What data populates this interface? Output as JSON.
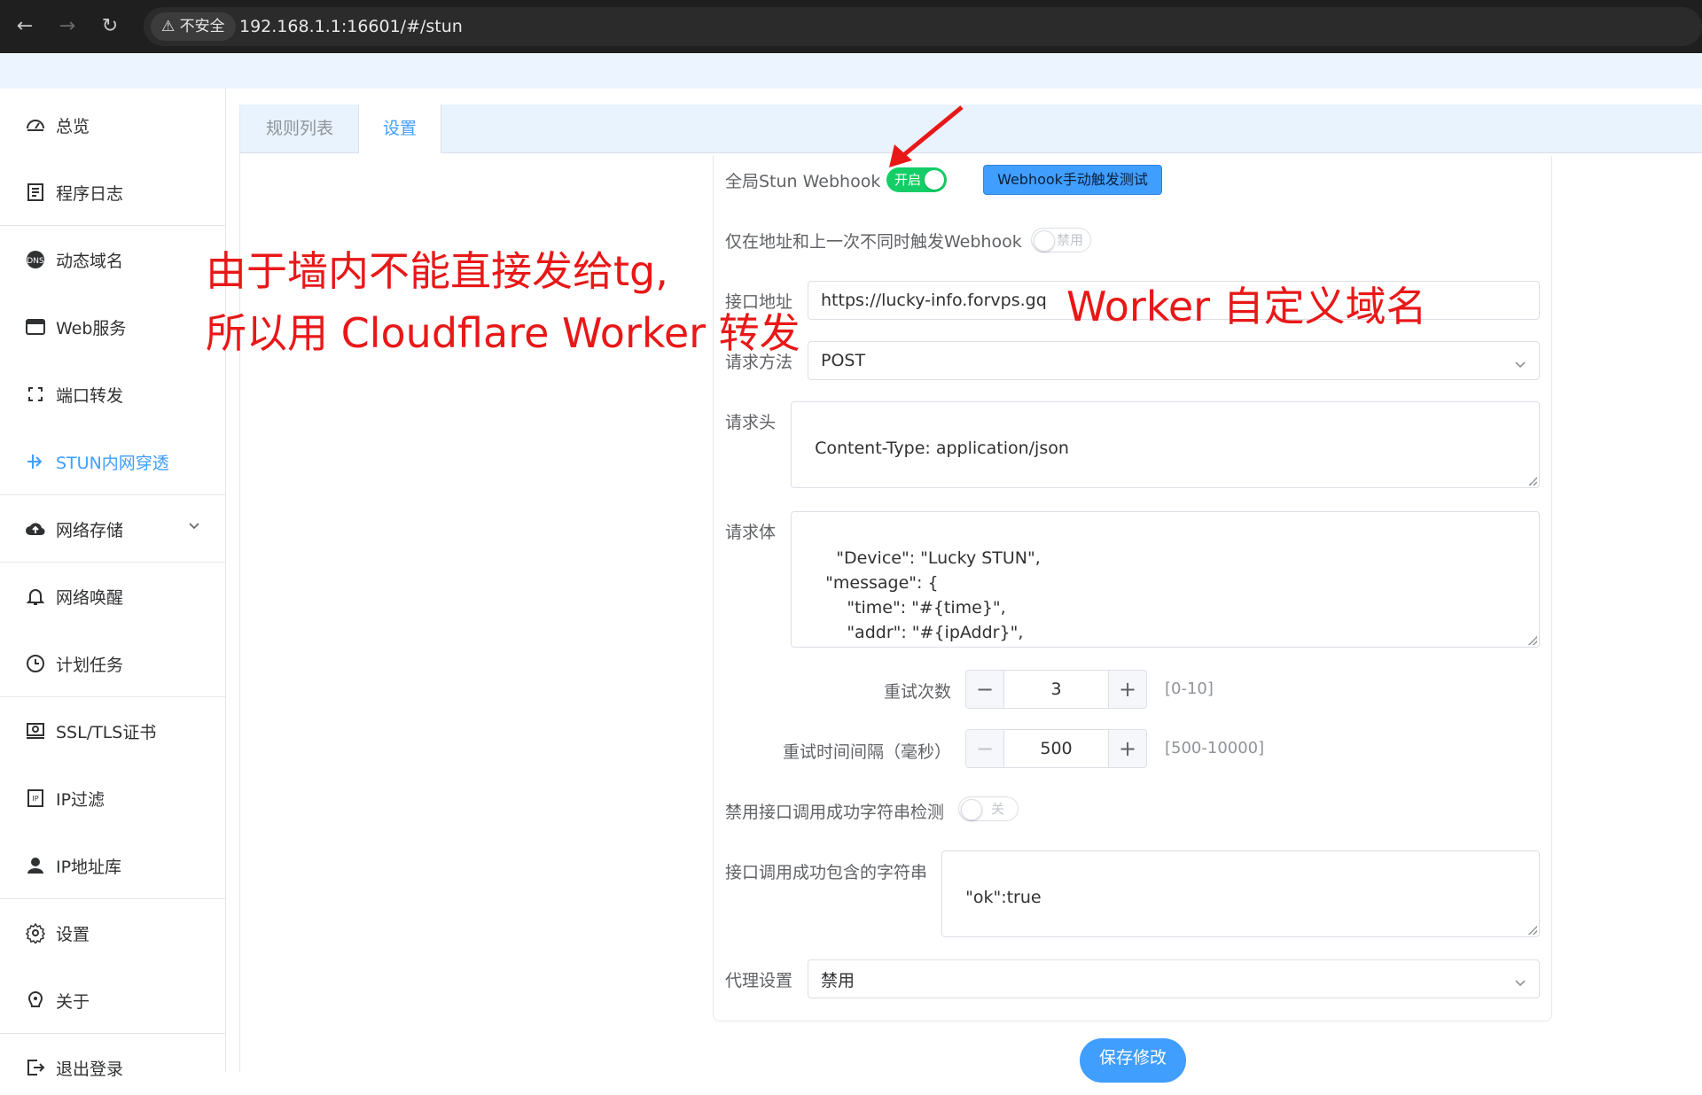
{
  "browser": {
    "security_label": "不安全",
    "url": "192.168.1.1:16601/#/stun"
  },
  "sidebar": {
    "items": [
      {
        "label": "总览",
        "icon": "dashboard-icon"
      },
      {
        "label": "程序日志",
        "icon": "log-icon"
      },
      {
        "label": "动态域名",
        "icon": "dns-icon"
      },
      {
        "label": "Web服务",
        "icon": "web-icon"
      },
      {
        "label": "端口转发",
        "icon": "port-forward-icon"
      },
      {
        "label": "STUN内网穿透",
        "icon": "stun-icon"
      },
      {
        "label": "网络存储",
        "icon": "cloud-storage-icon"
      },
      {
        "label": "网络唤醒",
        "icon": "bell-icon"
      },
      {
        "label": "计划任务",
        "icon": "clock-icon"
      },
      {
        "label": "SSL/TLS证书",
        "icon": "certificate-icon"
      },
      {
        "label": "IP过滤",
        "icon": "ip-filter-icon"
      },
      {
        "label": "IP地址库",
        "icon": "ip-database-icon"
      },
      {
        "label": "设置",
        "icon": "gear-icon"
      },
      {
        "label": "关于",
        "icon": "about-icon"
      },
      {
        "label": "退出登录",
        "icon": "logout-icon"
      }
    ],
    "active_index": 5
  },
  "tabs": [
    {
      "label": "规则列表"
    },
    {
      "label": "设置"
    }
  ],
  "form": {
    "global_webhook": {
      "label": "全局Stun Webhook",
      "switch_text": "开启",
      "on": true
    },
    "test_button_label": "Webhook手动触发测试",
    "only_on_change": {
      "label": "仅在地址和上一次不同时触发Webhook",
      "switch_text": "禁用",
      "on": false
    },
    "api_url": {
      "label": "接口地址",
      "value": "https://lucky-info.forvps.gq"
    },
    "method": {
      "label": "请求方法",
      "value": "POST"
    },
    "headers": {
      "label": "请求头",
      "value": "Content-Type: application/json"
    },
    "body": {
      "label": "请求体",
      "value": "    \"Device\": \"Lucky STUN\",\n    \"message\": {\n        \"time\": \"#{time}\",\n        \"addr\": \"#{ipAddr}\",\n        \"rule name\": \"#{ruleName}\""
    },
    "retry_count": {
      "label": "重试次数",
      "value": "3",
      "range": "[0-10]"
    },
    "retry_interval": {
      "label": "重试时间间隔（毫秒）",
      "value": "500",
      "range": "[500-10000]"
    },
    "disable_success_check": {
      "label": "禁用接口调用成功字符串检测",
      "switch_text": "关",
      "on": false
    },
    "success_string": {
      "label": "接口调用成功包含的字符串",
      "value": "\"ok\":true"
    },
    "proxy": {
      "label": "代理设置",
      "value": "禁用"
    },
    "save_label": "保存修改"
  },
  "annotations": {
    "line1": "由于墙内不能直接发给tg,",
    "line2": "所以用 Cloudflare Worker 转发",
    "worker_domain": "Worker 自定义域名"
  },
  "colors": {
    "accent": "#409eff",
    "switch_on": "#13ce66",
    "switch_off": "#dcdfe6",
    "annotation": "#e81818"
  }
}
